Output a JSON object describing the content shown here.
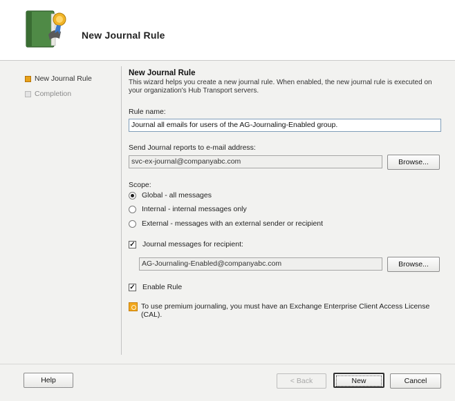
{
  "wizard": {
    "title": "New Journal Rule",
    "icon": "journal-book-icon"
  },
  "nav": {
    "items": [
      {
        "label": "New Journal Rule",
        "state": "active"
      },
      {
        "label": "Completion",
        "state": "inactive"
      }
    ]
  },
  "content": {
    "section_title": "New Journal Rule",
    "description": "This wizard helps you create a new journal rule. When enabled, the new journal rule is executed on your organization's Hub Transport servers.",
    "rule_name_label": "Rule name:",
    "rule_name_value": "Journal all emails for users of the AG-Journaling-Enabled group.",
    "send_reports_label": "Send Journal reports to e-mail address:",
    "send_reports_value": "svc-ex-journal@companyabc.com",
    "browse_label": "Browse...",
    "scope_label": "Scope:",
    "scope_options": [
      {
        "label": "Global - all messages",
        "selected": true
      },
      {
        "label": "Internal - internal messages only",
        "selected": false
      },
      {
        "label": "External - messages with an external sender or recipient",
        "selected": false
      }
    ],
    "journal_recipient_label": "Journal messages for recipient:",
    "journal_recipient_checked": true,
    "journal_recipient_value": "AG-Journaling-Enabled@companyabc.com",
    "enable_rule_label": "Enable Rule",
    "enable_rule_checked": true,
    "note_icon": "info-warning-icon",
    "note_text": "To use premium journaling, you must have an Exchange Enterprise Client Access License (CAL)."
  },
  "footer": {
    "help_label": "Help",
    "back_label": "< Back",
    "new_label": "New",
    "cancel_label": "Cancel"
  },
  "colors": {
    "accent": "#e8a21a",
    "input_border": "#7f9db9"
  }
}
